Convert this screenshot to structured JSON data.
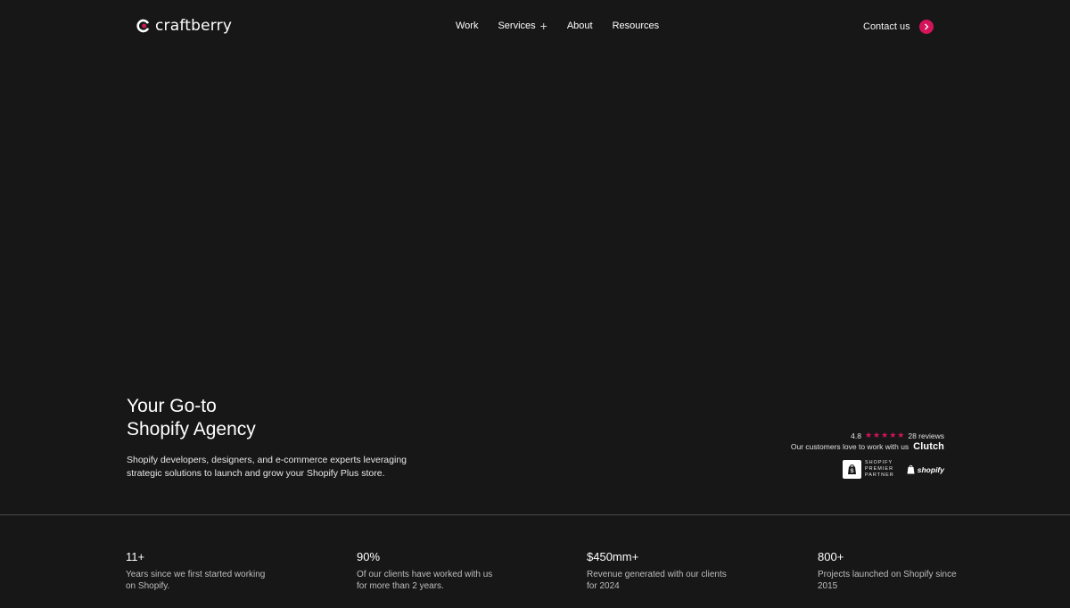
{
  "brand": {
    "name": "craftberry",
    "accent": "#d4145a",
    "background": "#171717"
  },
  "nav": {
    "items": [
      {
        "label": "Work"
      },
      {
        "label": "Services",
        "icon": "plus-icon"
      },
      {
        "label": "About"
      },
      {
        "label": "Resources"
      }
    ],
    "contact_label": "Contact us"
  },
  "hero": {
    "title_line1": "Your Go-to",
    "title_line2": "Shopify Agency",
    "subtitle": "Shopify developers, designers, and e-commerce experts leveraging strategic solutions to launch and grow your Shopify Plus store."
  },
  "trust": {
    "rating": "4.8",
    "stars": 5,
    "reviews": "28 reviews",
    "tagline": "Our customers love to work with us",
    "clutch": "Clutch",
    "partner_line1": "SHOPIFY",
    "partner_line2": "PREMIER",
    "partner_line3": "PARTNER",
    "shopify": "shopify"
  },
  "stats": [
    {
      "value": "11+",
      "desc": "Years since we first started working on Shopify."
    },
    {
      "value": "90%",
      "desc": "Of our clients have worked with us for more than 2 years."
    },
    {
      "value": "$450mm+",
      "desc": "Revenue generated with our clients for 2024"
    },
    {
      "value": "800+",
      "desc": "Projects launched on Shopify since 2015"
    }
  ]
}
